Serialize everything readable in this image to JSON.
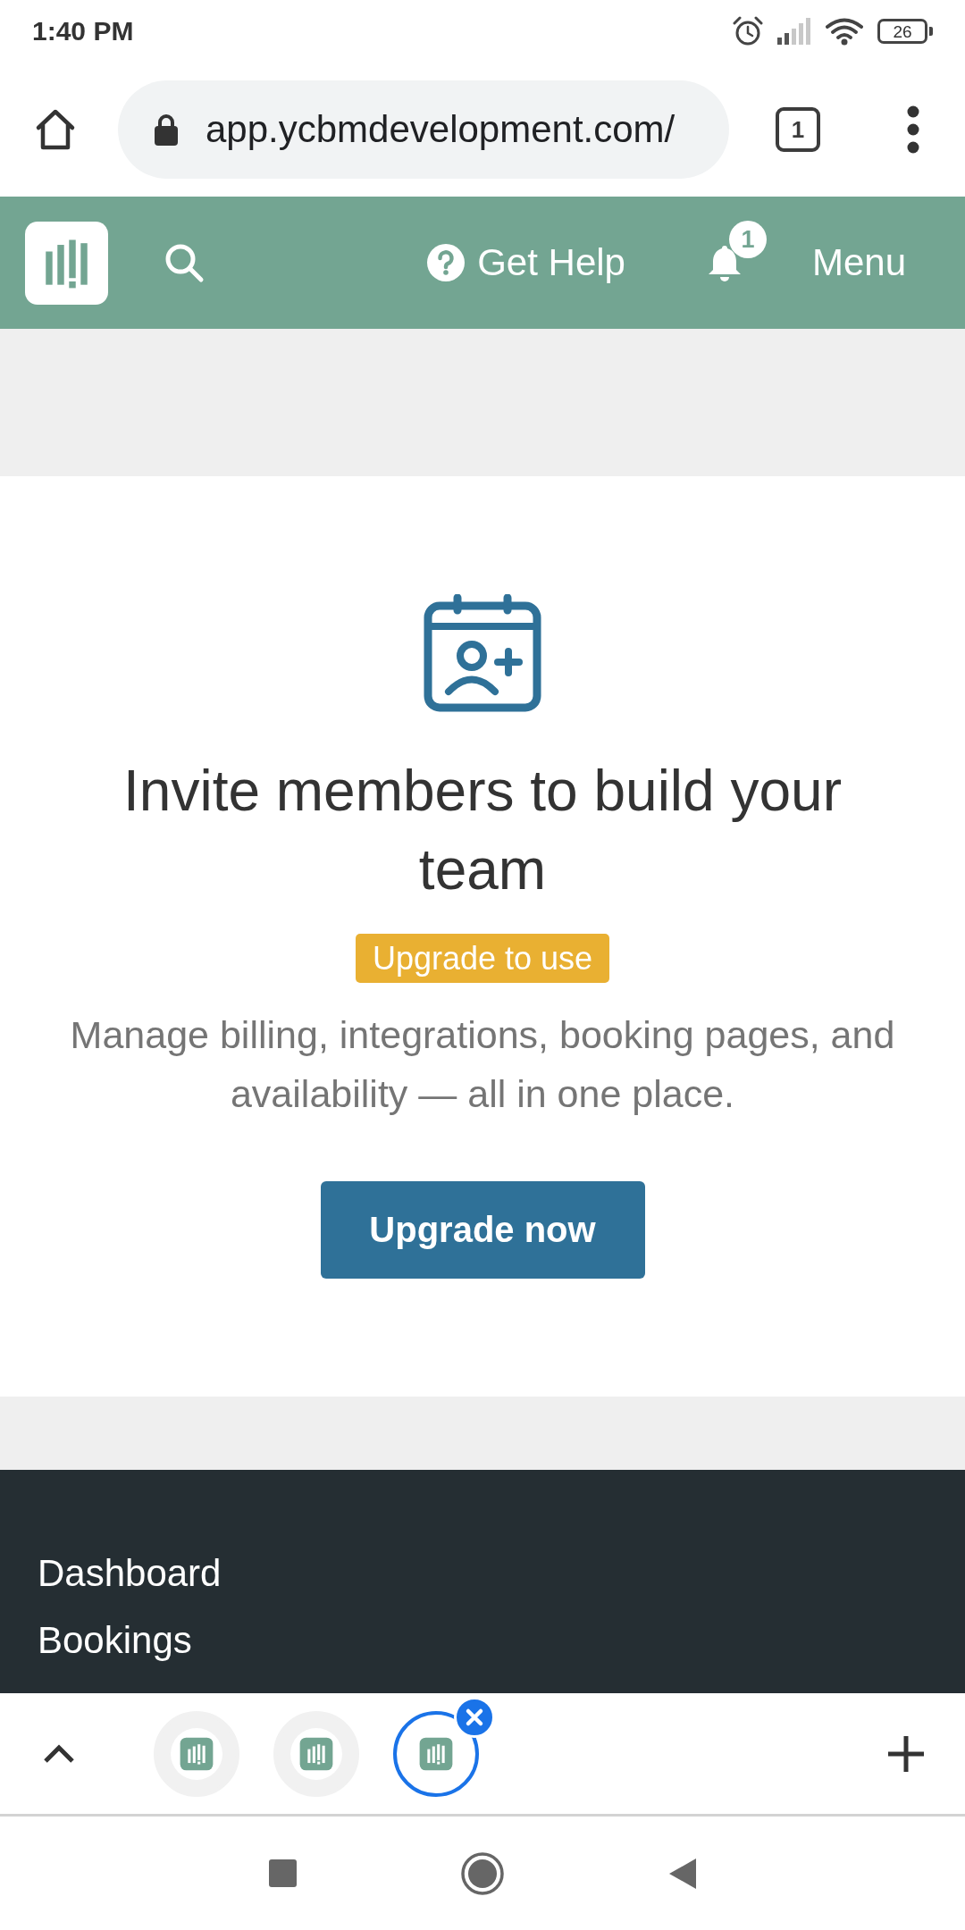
{
  "status_bar": {
    "time": "1:40 PM",
    "battery": "26"
  },
  "browser_bar": {
    "url": "app.ycbmdevelopment.com/",
    "tab_count": "1"
  },
  "header": {
    "help_label": "Get Help",
    "notification_count": "1",
    "menu_label": "Menu"
  },
  "upsell": {
    "title": "Invite members to build your team",
    "badge": "Upgrade to use",
    "description": "Manage billing, integrations, booking pages, and availability — all in one place.",
    "button": "Upgrade now"
  },
  "footer": {
    "links": [
      "Dashboard",
      "Bookings"
    ]
  },
  "tab_switcher": {
    "tabs": [
      {
        "selected": false
      },
      {
        "selected": false
      },
      {
        "selected": true
      }
    ]
  }
}
